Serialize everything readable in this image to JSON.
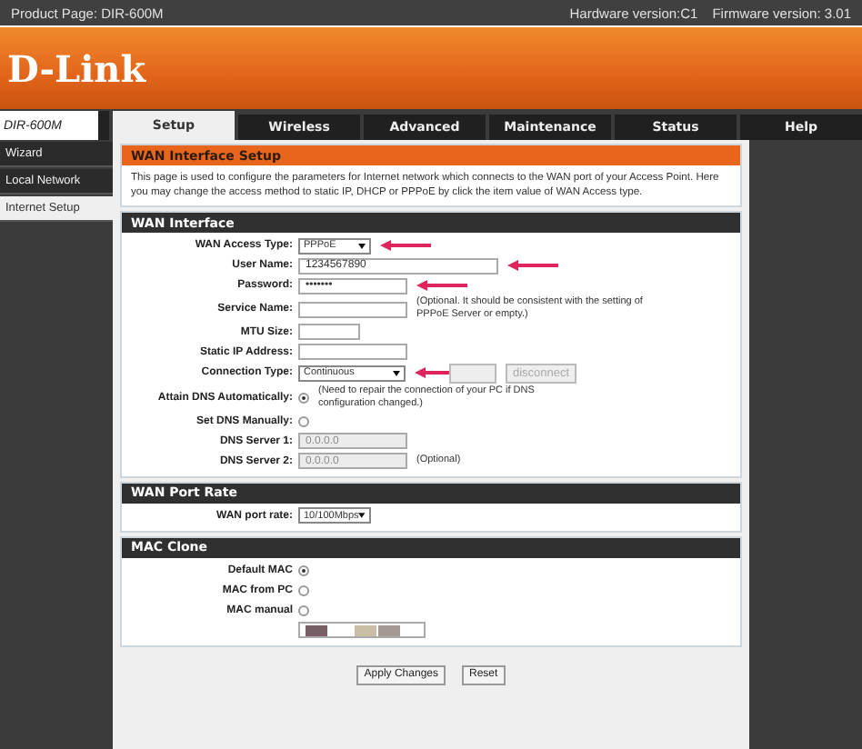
{
  "top_bar": {
    "product": "Product Page: DIR-600M",
    "hardware": "Hardware version:C1",
    "firmware": "Firmware version: 3.01"
  },
  "banner": {
    "logo": "D-Link"
  },
  "model": "DIR-600M",
  "tabs": [
    {
      "label": "Setup",
      "selected": true
    },
    {
      "label": "Wireless",
      "selected": false
    },
    {
      "label": "Advanced",
      "selected": false
    },
    {
      "label": "Maintenance",
      "selected": false
    },
    {
      "label": "Status",
      "selected": false
    },
    {
      "label": "Help",
      "selected": false
    }
  ],
  "sidebar": {
    "items": [
      {
        "label": "Wizard",
        "selected": false
      },
      {
        "label": "Local Network",
        "selected": false
      },
      {
        "label": "Internet Setup",
        "selected": true
      }
    ]
  },
  "intro": {
    "title": "WAN Interface Setup",
    "text": "This page is used to configure the parameters for Internet network which connects to the WAN port of your Access Point. Here you may change the access method to static IP, DHCP or PPPoE by click the item value of WAN Access type."
  },
  "wan_interface": {
    "title": "WAN Interface",
    "rows": [
      {
        "kind": "select",
        "label": "WAN Access Type:",
        "value": "PPPoE",
        "arrow": true
      },
      {
        "kind": "wide-text",
        "label": "User Name:",
        "value": "1234567890",
        "arrow": true
      },
      {
        "kind": "text",
        "label": "Password:",
        "value": "•••••••",
        "arrow": true
      },
      {
        "kind": "text",
        "label": "Service Name:",
        "note": "(Optional. It should be consistent with the setting of PPPoE Server or empty.)"
      },
      {
        "kind": "short-text",
        "label": "MTU Size:"
      },
      {
        "kind": "text",
        "label": "Static IP Address:"
      },
      {
        "kind": "connection",
        "label": "Connection Type:",
        "value": "Continuous",
        "button": "disconnect",
        "arrow": true
      },
      {
        "kind": "radio",
        "label": "Attain DNS Automatically:",
        "selected": true,
        "note": "(Need to repair the connection of your PC if DNS configuration changed.)"
      },
      {
        "kind": "radio",
        "label": "Set DNS Manually:",
        "selected": false
      },
      {
        "kind": "text",
        "label": "DNS Server 1:",
        "value": "0.0.0.0",
        "disabled": true
      },
      {
        "kind": "text",
        "label": "DNS Server 2:",
        "value": "0.0.0.0",
        "disabled": true,
        "note": "(Optional)"
      }
    ]
  },
  "wan_port_rate": {
    "title": "WAN Port Rate",
    "rows": [
      {
        "kind": "select",
        "label": "WAN port rate:",
        "value": "10/100Mbps"
      }
    ]
  },
  "mac_clone": {
    "title": "MAC Clone",
    "rows": [
      {
        "kind": "radio",
        "label": "Default MAC",
        "selected": true
      },
      {
        "kind": "radio",
        "label": "MAC from PC",
        "selected": false
      },
      {
        "kind": "radio",
        "label": "MAC manual",
        "selected": false
      },
      {
        "kind": "mac",
        "label": ""
      }
    ]
  },
  "buttons": [
    "Apply Changes",
    "Reset"
  ]
}
